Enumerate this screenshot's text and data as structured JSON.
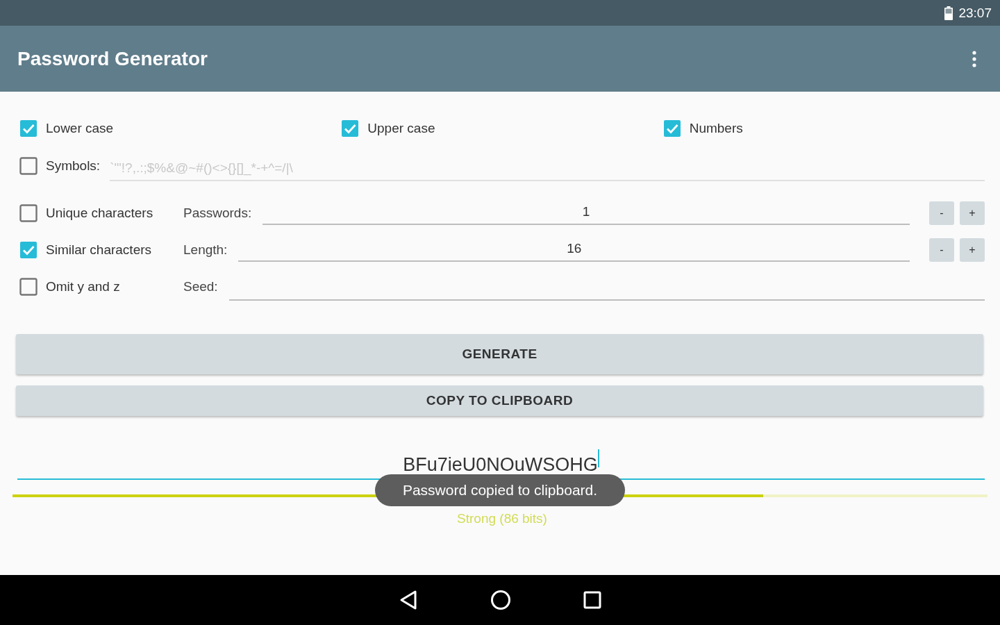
{
  "status_bar": {
    "time": "23:07"
  },
  "app_bar": {
    "title": "Password Generator"
  },
  "char_options": [
    {
      "label": "Lower case",
      "checked": true
    },
    {
      "label": "Upper case",
      "checked": true
    },
    {
      "label": "Numbers",
      "checked": true
    }
  ],
  "symbols": {
    "label": "Symbols:",
    "checked": false,
    "placeholder": "`\"'!?,.:;$%&@~#()<>{}[]_*-+^=/|\\"
  },
  "options": [
    {
      "label": "Unique characters",
      "checked": false
    },
    {
      "label": "Similar characters",
      "checked": true
    },
    {
      "label": "Omit y and z",
      "checked": false
    }
  ],
  "fields": [
    {
      "label": "Passwords:",
      "value": "1",
      "kind": "stepper",
      "minus": "-",
      "plus": "+"
    },
    {
      "label": "Length:",
      "value": "16",
      "kind": "stepper",
      "minus": "-",
      "plus": "+"
    },
    {
      "label": "Seed:",
      "kind": "text"
    }
  ],
  "buttons": [
    "GENERATE",
    "COPY TO CLIPBOARD"
  ],
  "password": {
    "value": "BFu7ieU0NOuWSOHG"
  },
  "strength": {
    "level": 0.77,
    "text": "Strong (86 bits)"
  },
  "toast": {
    "text": "Password copied to clipboard."
  }
}
